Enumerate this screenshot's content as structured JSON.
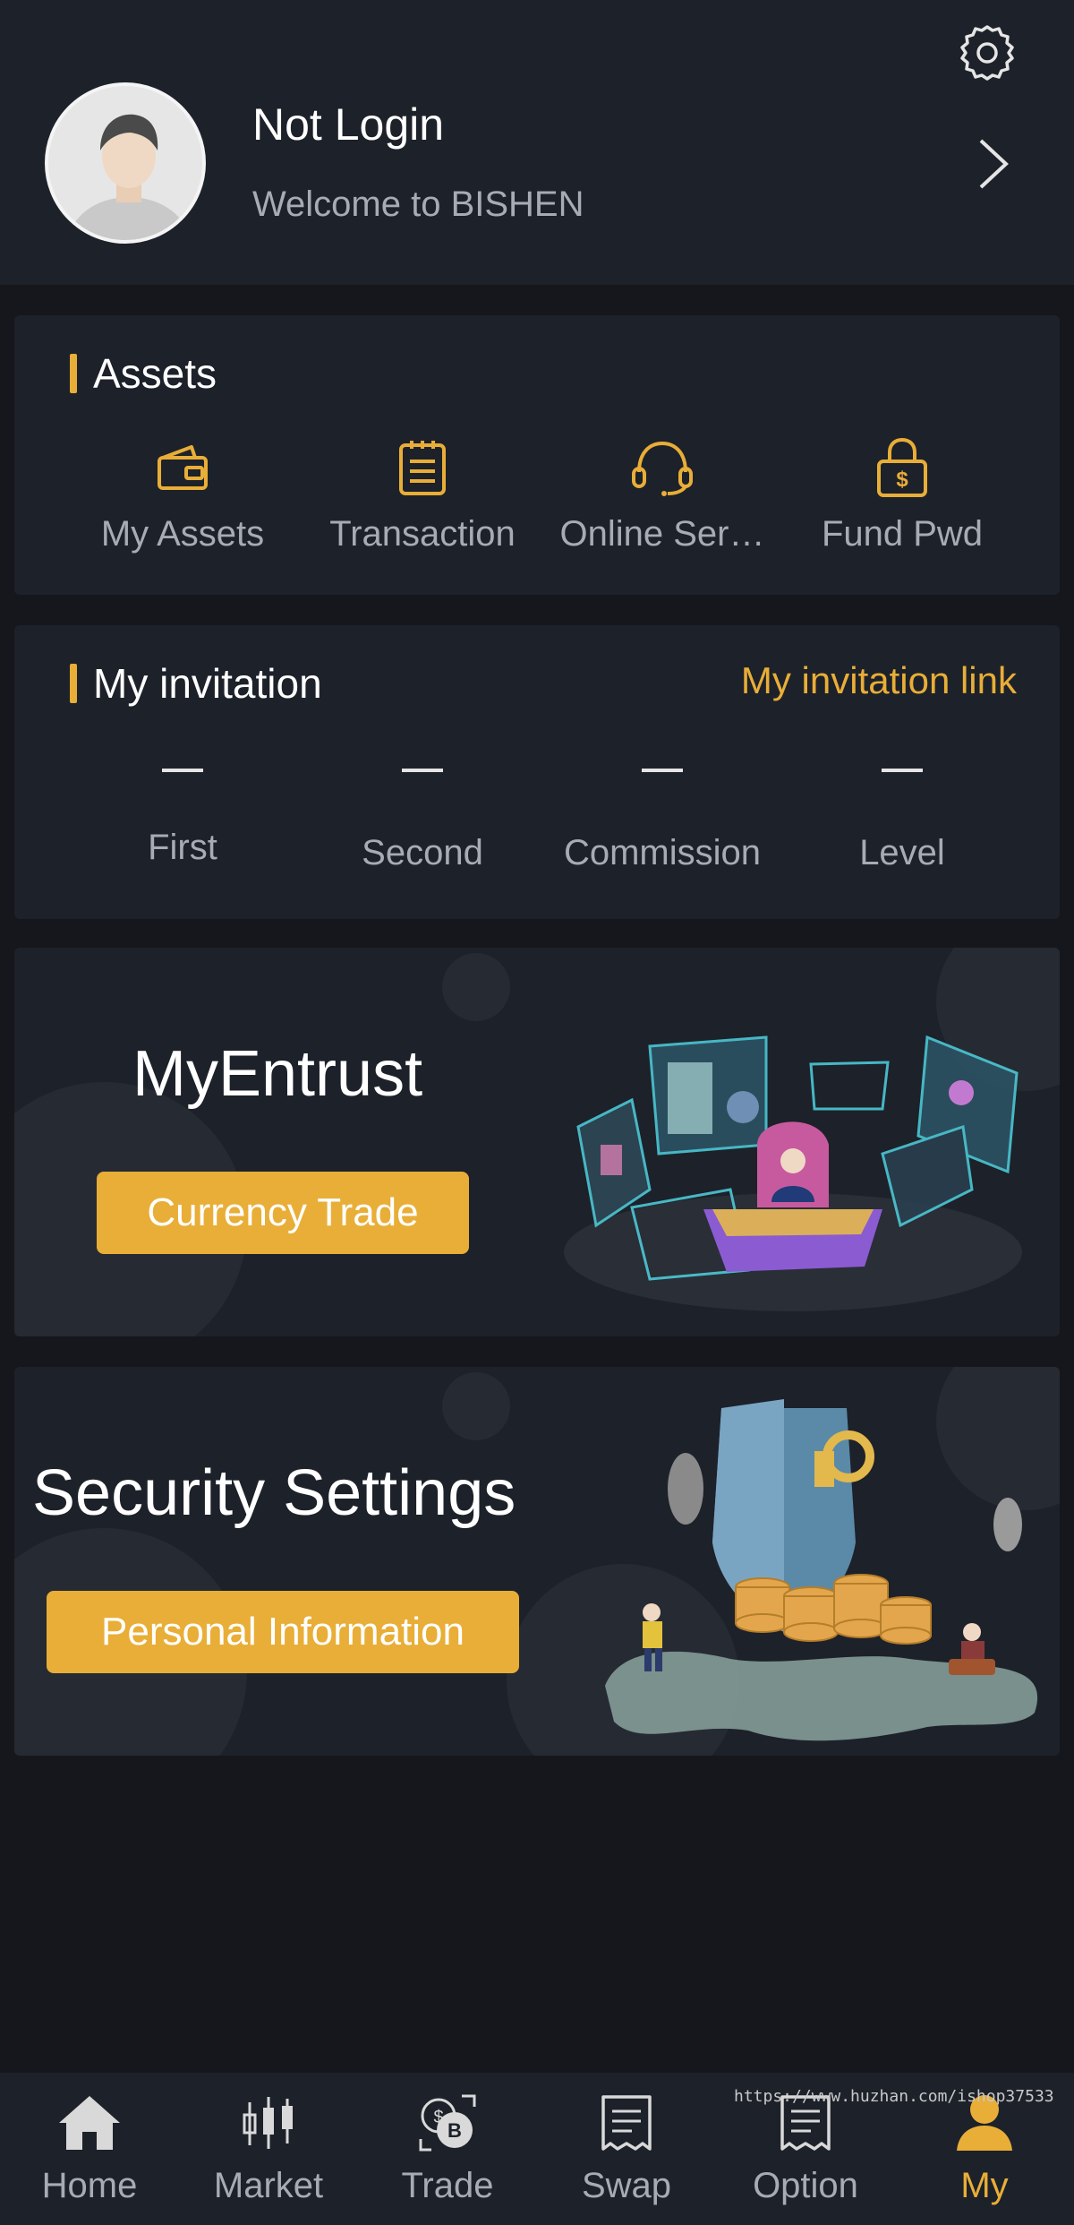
{
  "profile": {
    "name": "Not Login",
    "welcome": "Welcome to BISHEN"
  },
  "assets": {
    "title": "Assets",
    "items": [
      {
        "label": "My Assets",
        "icon": "wallet-icon"
      },
      {
        "label": "Transaction",
        "icon": "clipboard-list-icon"
      },
      {
        "label": "Online Ser…",
        "icon": "headset-icon"
      },
      {
        "label": "Fund Pwd",
        "icon": "lock-dollar-icon"
      }
    ]
  },
  "invitation": {
    "title": "My invitation",
    "link_label": "My invitation link",
    "stats": [
      {
        "value": "—",
        "label": "First"
      },
      {
        "value": "—",
        "label": "Second"
      },
      {
        "value": "—",
        "label": "Commission"
      },
      {
        "value": "—",
        "label": "Level"
      }
    ]
  },
  "entrust": {
    "title": "MyEntrust",
    "button": "Currency Trade"
  },
  "security": {
    "title": "Security Settings",
    "button": "Personal Information"
  },
  "tabbar": {
    "items": [
      {
        "label": "Home",
        "icon": "home-icon"
      },
      {
        "label": "Market",
        "icon": "candlestick-icon"
      },
      {
        "label": "Trade",
        "icon": "bitcoin-exchange-icon"
      },
      {
        "label": "Swap",
        "icon": "receipt-icon"
      },
      {
        "label": "Option",
        "icon": "receipt-icon"
      },
      {
        "label": "My",
        "icon": "user-icon"
      }
    ],
    "active": "My"
  },
  "watermark": "https://www.huzhan.com/ishop37533",
  "colors": {
    "accent": "#e8ae37",
    "background": "#15171c",
    "card": "#1d212a",
    "muted_text": "#a7abb3"
  }
}
